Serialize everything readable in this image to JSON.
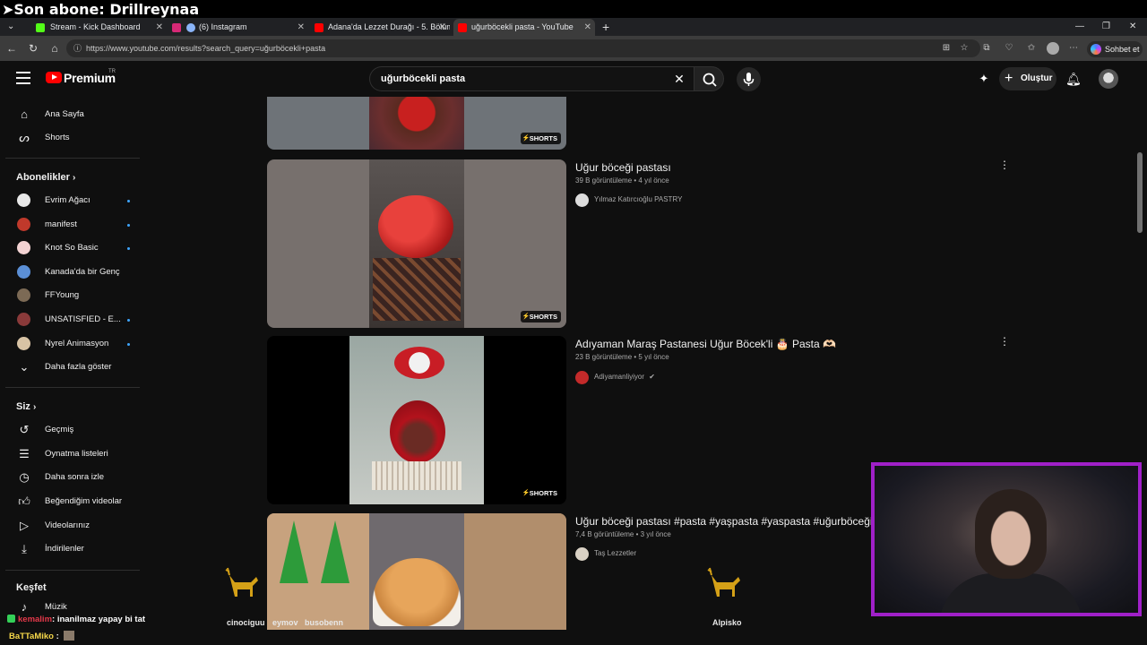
{
  "stream_overlay": {
    "banner": "➤Son abone: Drillreynaa",
    "chat": [
      {
        "user": "kemalim",
        "message": ": inanilmaz yapay bi tat"
      },
      {
        "user": "BaTTaMiko",
        "message": " :"
      }
    ],
    "alert_names": [
      "cinociguu",
      "eymov",
      "busobenn",
      "Alpisko"
    ]
  },
  "browser": {
    "tabs": [
      {
        "label": "Stream - Kick Dashboard",
        "favicon_color": "#53fc18"
      },
      {
        "label": "(6) Instagram",
        "favicon_color": "#d62976"
      },
      {
        "label": "Adana'da Lezzet Durağı - 5. Bölüm",
        "favicon_color": "#ff0000"
      },
      {
        "label": "uğurböcekli pasta - YouTube",
        "favicon_color": "#ff0000"
      }
    ],
    "new_tab": "+",
    "url": "https://www.youtube.com/results?search_query=uğurböcekli+pasta",
    "copilot_label": "Sohbet et"
  },
  "youtube": {
    "brand": "Premium",
    "country": "TR",
    "search_query": "uğurböcekli pasta",
    "create_label": "Oluştur",
    "sidebar": {
      "top": [
        {
          "label": "Ana Sayfa",
          "icon": "home-icon"
        },
        {
          "label": "Shorts",
          "icon": "shorts-icon"
        }
      ],
      "subscriptions_title": "Abonelikler",
      "subscriptions": [
        {
          "label": "Evrim Ağacı",
          "color": "#e8e8e8",
          "new": true
        },
        {
          "label": "manifest",
          "color": "#c0392b",
          "new": true
        },
        {
          "label": "Knot So Basic",
          "color": "#f3d3d3",
          "new": true
        },
        {
          "label": "Kanada'da bir Genç",
          "color": "#5b8fd6",
          "new": false
        },
        {
          "label": "FFYoung",
          "color": "#7c6a55",
          "new": false
        },
        {
          "label": "UNSATISFIED - E...",
          "color": "#8a3a3a",
          "new": true
        },
        {
          "label": "Nyrel Animasyon",
          "color": "#d8c3a5",
          "new": true
        }
      ],
      "show_more": "Daha fazla göster",
      "you_title": "Siz",
      "you_items": [
        {
          "label": "Geçmiş",
          "icon": "history-icon"
        },
        {
          "label": "Oynatma listeleri",
          "icon": "playlist-icon"
        },
        {
          "label": "Daha sonra izle",
          "icon": "watch-later-icon"
        },
        {
          "label": "Beğendiğim videolar",
          "icon": "like-icon"
        },
        {
          "label": "Videolarınız",
          "icon": "your-videos-icon"
        },
        {
          "label": "İndirilenler",
          "icon": "download-icon"
        }
      ],
      "explore_title": "Keşfet",
      "explore_items": [
        {
          "label": "Müzik",
          "icon": "music-icon"
        }
      ]
    },
    "results": [
      {
        "title": "",
        "views": "",
        "age": "",
        "channel": "",
        "badge": "SHORTS"
      },
      {
        "title": "Uğur böceği pastası",
        "views": "39 B görüntüleme",
        "age": "4 yıl önce",
        "channel": "Yılmaz Katırcıoğlu PASTRY",
        "badge": "SHORTS"
      },
      {
        "title": "Adıyaman Maraş Pastanesi Uğur Böcek'li 🎂 Pasta 🫶🏻",
        "views": "23 B görüntüleme",
        "age": "5 yıl önce",
        "channel": "Adiyamanliyiyor",
        "verified": "✔",
        "badge": "SHORTS"
      },
      {
        "title": "Uğur böceği pastası #pasta #yaşpasta #yaspasta #uğurböceği",
        "views": "7,4 B görüntüleme",
        "age": "3 yıl önce",
        "channel": "Taş Lezzetler",
        "badge": ""
      }
    ]
  }
}
